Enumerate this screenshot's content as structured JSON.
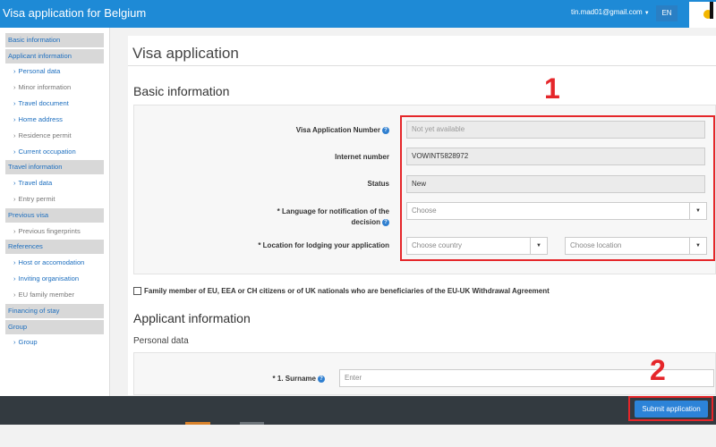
{
  "header": {
    "title": "Visa application for Belgium",
    "user": "tin.mad01@gmail.com",
    "language": "EN",
    "colors": {
      "bar": "#1e8ad6",
      "logo_dot": "#f3b600"
    }
  },
  "sidebar": {
    "items": [
      {
        "label": "Basic information",
        "type": "section"
      },
      {
        "label": "Applicant information",
        "type": "section"
      },
      {
        "label": "Personal data",
        "type": "sub"
      },
      {
        "label": "Minor information",
        "type": "sub-muted"
      },
      {
        "label": "Travel document",
        "type": "sub"
      },
      {
        "label": "Home address",
        "type": "sub"
      },
      {
        "label": "Residence permit",
        "type": "sub-muted"
      },
      {
        "label": "Current occupation",
        "type": "sub"
      },
      {
        "label": "Travel information",
        "type": "section"
      },
      {
        "label": "Travel data",
        "type": "sub"
      },
      {
        "label": "Entry permit",
        "type": "sub-muted"
      },
      {
        "label": "Previous visa",
        "type": "section"
      },
      {
        "label": "Previous fingerprints",
        "type": "sub-muted"
      },
      {
        "label": "References",
        "type": "section"
      },
      {
        "label": "Host or accomodation",
        "type": "sub"
      },
      {
        "label": "Inviting organisation",
        "type": "sub"
      },
      {
        "label": "EU family member",
        "type": "sub-muted"
      },
      {
        "label": "Financing of stay",
        "type": "section"
      },
      {
        "label": "Group",
        "type": "section"
      },
      {
        "label": "Group",
        "type": "sub"
      }
    ]
  },
  "main": {
    "page_title": "Visa application",
    "basic_info": {
      "title": "Basic information",
      "visa_number": {
        "label": "Visa Application Number",
        "value": "Not yet available"
      },
      "internet_number": {
        "label": "Internet number",
        "value": "VOWINT5828972"
      },
      "status": {
        "label": "Status",
        "value": "New"
      },
      "language": {
        "label_line1": "* Language for notification of the",
        "label_line2": "decision",
        "placeholder": "Choose"
      },
      "location": {
        "label": "* Location for lodging your application",
        "country_placeholder": "Choose country",
        "location_placeholder": "Choose location"
      }
    },
    "family_member_checkbox": "Family member of EU, EEA or CH citizens or of UK nationals who are beneficiaries of the EU-UK Withdrawal Agreement",
    "applicant_info": {
      "title": "Applicant information",
      "subtitle": "Personal data",
      "surname": {
        "label": "* 1. Surname",
        "placeholder": "Enter"
      }
    }
  },
  "annotations": {
    "one": "1",
    "two": "2",
    "color": "#e5262a"
  },
  "footer": {
    "submit_label": "Submit application"
  }
}
